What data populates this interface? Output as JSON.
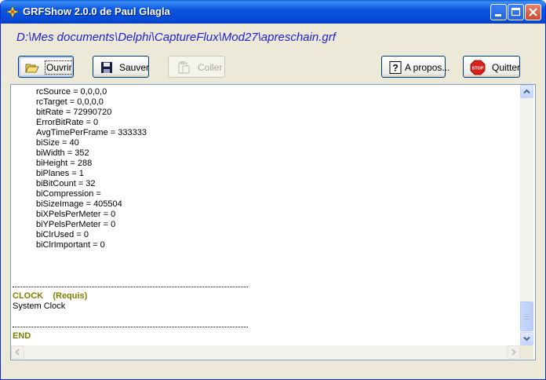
{
  "window": {
    "title": "GRFShow 2.0.0 de Paul Glagla"
  },
  "file_path": "D:\\Mes documents\\Delphi\\CaptureFlux\\Mod27\\apreschain.grf",
  "toolbar": {
    "open_label": "Ouvrir",
    "save_label": "Sauver",
    "paste_label": "Coller",
    "about_label": "A propos...",
    "quit_label": "Quitter"
  },
  "memo": {
    "properties": [
      "rcSource = 0,0,0,0",
      "rcTarget = 0,0,0,0",
      "bitRate = 72990720",
      "ErrorBitRate = 0",
      "AvgTimePerFrame = 333333",
      "biSize = 40",
      "biWidth = 352",
      "biHeight = 288",
      "biPlanes = 1",
      "biBitCount = 32",
      "biCompression =",
      "biSizeImage = 405504",
      "biXPelsPerMeter = 0",
      "biYPelsPerMeter = 0",
      "biClrUsed = 0",
      "biClrImportant = 0"
    ],
    "clock_header": "CLOCK    (Requis)",
    "clock_name": "System Clock",
    "end_label": "END"
  },
  "colors": {
    "path_text": "#2020cc",
    "section_header": "#7f7f00",
    "title_bar": "#0b56e0"
  }
}
